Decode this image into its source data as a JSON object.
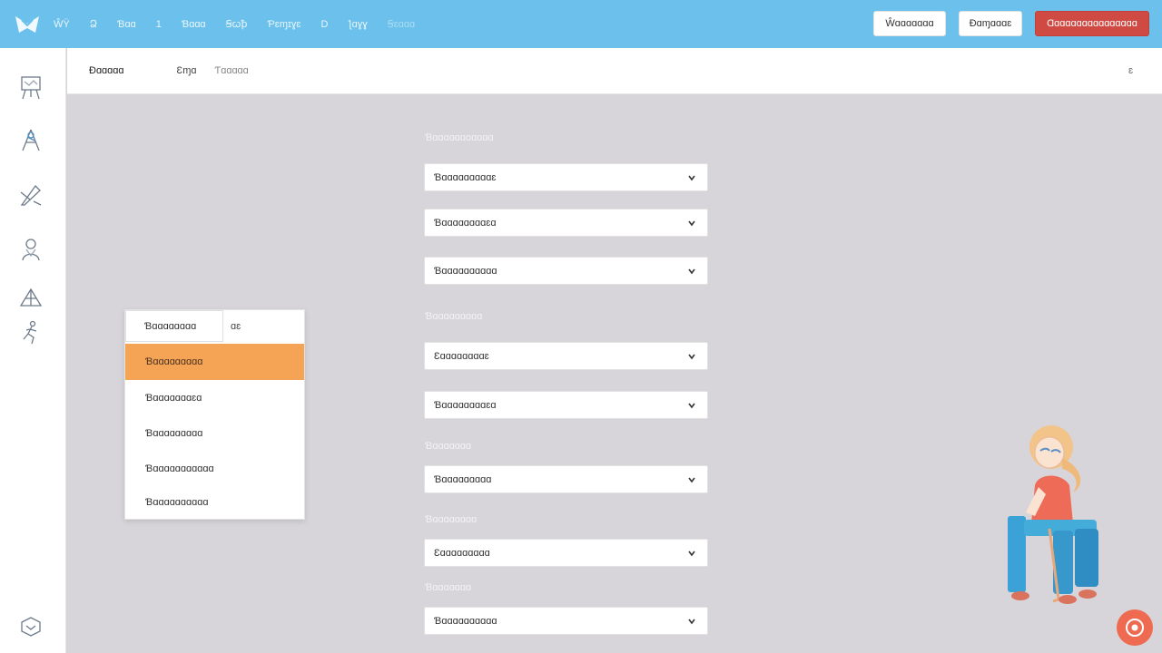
{
  "topbar": {
    "nav": [
      "ŴΫ",
      "Ձ",
      "Ɓɑɑ",
      "1",
      "Ɓɑɑɑ",
      "Ꞩꞷꝥ",
      "Ƥɛɱɪɣɛ",
      "D",
      "ƪɑɣɣ",
      "Ꞩɛɑɑɑ"
    ],
    "actions": {
      "secondary_1": "Ŵɑɑɑɑɑɑɑ",
      "secondary_2": "Ɖɑɱɑɑɑɛ",
      "danger": "Ɑɑɑɑɑɑɑɑɑɑɑɑɑɑɑɑ"
    }
  },
  "subheader": {
    "title": "Ɖɑɑɑɑɑ",
    "tab": "Ɛɱɑ",
    "tab_secondary": "Ƭɑɑɑɑɑ",
    "right": "ɛ"
  },
  "form": {
    "sections": [
      {
        "label": "Ɓɑɑɑɑɑɑɑɑɑɑɑ",
        "fields": [
          "Ɓɑɑɑɑɑɑɑɑɑɛ",
          "Ɓɑɑɑɑɑɑɑɑɛɑ",
          "Ɓɑɑɑɑɑɑɑɑɑɑ"
        ]
      },
      {
        "label": "Ɓɑɑɑɑɑɑɑɑɑ",
        "fields": [
          "Ɛɑɑɑɑɑɑɑɑɛ",
          "Ɓɑɑɑɑɑɑɑɑɛɑ"
        ]
      },
      {
        "label": "Ɓɑɑɑɑɑɑɑ",
        "fields": [
          "Ɓɑɑɑɑɑɑɑɑɑ"
        ]
      },
      {
        "label": "Ɓɑɑɑɑɑɑɑɑ",
        "fields": [
          "Ɛɑɑɑɑɑɑɑɑɑ"
        ]
      },
      {
        "label": "Ɓɑɑɑɑɑɑɑ",
        "fields": [
          "Ɓɑɑɑɑɑɑɑɑɑɑ"
        ]
      }
    ]
  },
  "dropdown": {
    "input_value": "Ɓɑɑɑɑɑɑɑɑ",
    "filter_label": "ɑɛ",
    "options": [
      "Ɓɑɑɑɑɑɑɑɑɑ",
      "Ɓɑɑɑɑɑɑɑɛɑ",
      "Ɓɑɑɑɑɑɑɑɑɑ",
      "Ɓɑɑɑɑɑɑɑɑɑɑɑ",
      "Ɓɑɑɑɑɑɑɑɑɑɑ"
    ],
    "selected_index": 0
  },
  "icons": {
    "logo": "app-logo-icon",
    "rail": [
      "easel-icon",
      "compass-icon",
      "pen-tool-icon",
      "person-icon",
      "triangle-icon",
      "runner-icon"
    ],
    "rail_bottom": "settings-icon",
    "help": "help-icon",
    "chevron": "chevron-down-icon"
  },
  "colors": {
    "topbar": "#6cc1ec",
    "danger": "#cf4a43",
    "selected_option": "#f5a355",
    "background": "#d7d5da"
  }
}
